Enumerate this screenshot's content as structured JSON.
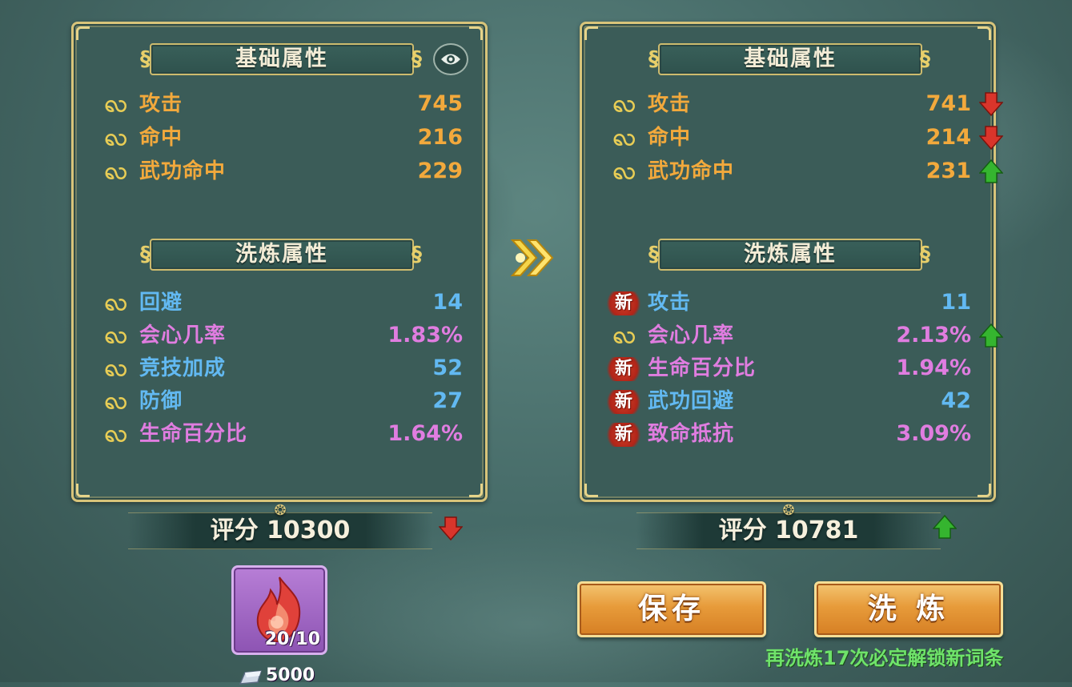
{
  "left_panel": {
    "base_title": "基础属性",
    "refine_title": "洗炼属性",
    "base_attrs": [
      {
        "name": "攻击",
        "value": "745"
      },
      {
        "name": "命中",
        "value": "216"
      },
      {
        "name": "武功命中",
        "value": "229"
      }
    ],
    "refine_attrs": [
      {
        "name": "回避",
        "value": "14",
        "color": "#62b9f2"
      },
      {
        "name": "会心几率",
        "value": "1.83%",
        "color": "#e07de0"
      },
      {
        "name": "竞技加成",
        "value": "52",
        "color": "#62b9f2"
      },
      {
        "name": "防御",
        "value": "27",
        "color": "#62b9f2"
      },
      {
        "name": "生命百分比",
        "value": "1.64%",
        "color": "#e07de0"
      }
    ],
    "score": "评分 10300",
    "score_trend": "down"
  },
  "right_panel": {
    "base_title": "基础属性",
    "refine_title": "洗炼属性",
    "base_attrs": [
      {
        "name": "攻击",
        "value": "741",
        "trend": "down"
      },
      {
        "name": "命中",
        "value": "214",
        "trend": "down"
      },
      {
        "name": "武功命中",
        "value": "231",
        "trend": "up"
      }
    ],
    "refine_attrs": [
      {
        "name": "攻击",
        "value": "11",
        "badge": "新",
        "color": "#62b9f2"
      },
      {
        "name": "会心几率",
        "value": "2.13%",
        "trend": "up",
        "color": "#e07de0"
      },
      {
        "name": "生命百分比",
        "value": "1.94%",
        "badge": "新",
        "color": "#e07de0"
      },
      {
        "name": "武功回避",
        "value": "42",
        "badge": "新",
        "color": "#62b9f2"
      },
      {
        "name": "致命抵抗",
        "value": "3.09%",
        "badge": "新",
        "color": "#e07de0"
      }
    ],
    "score": "评分 10781",
    "score_trend": "up"
  },
  "material": {
    "count": "20/10",
    "cost": "5000",
    "icon": "flame-stone-icon"
  },
  "buttons": {
    "save": "保存",
    "refine": "洗 炼"
  },
  "hint": "再洗炼17次必定解锁新词条",
  "colors": {
    "accent_gold": "#d8c47a",
    "name_orange": "#f2a93c",
    "value_blue": "#62b9f2",
    "value_pink": "#e07de0",
    "trend_up": "#35b52f",
    "trend_down": "#d9352b",
    "hint_green": "#6fe36a"
  }
}
